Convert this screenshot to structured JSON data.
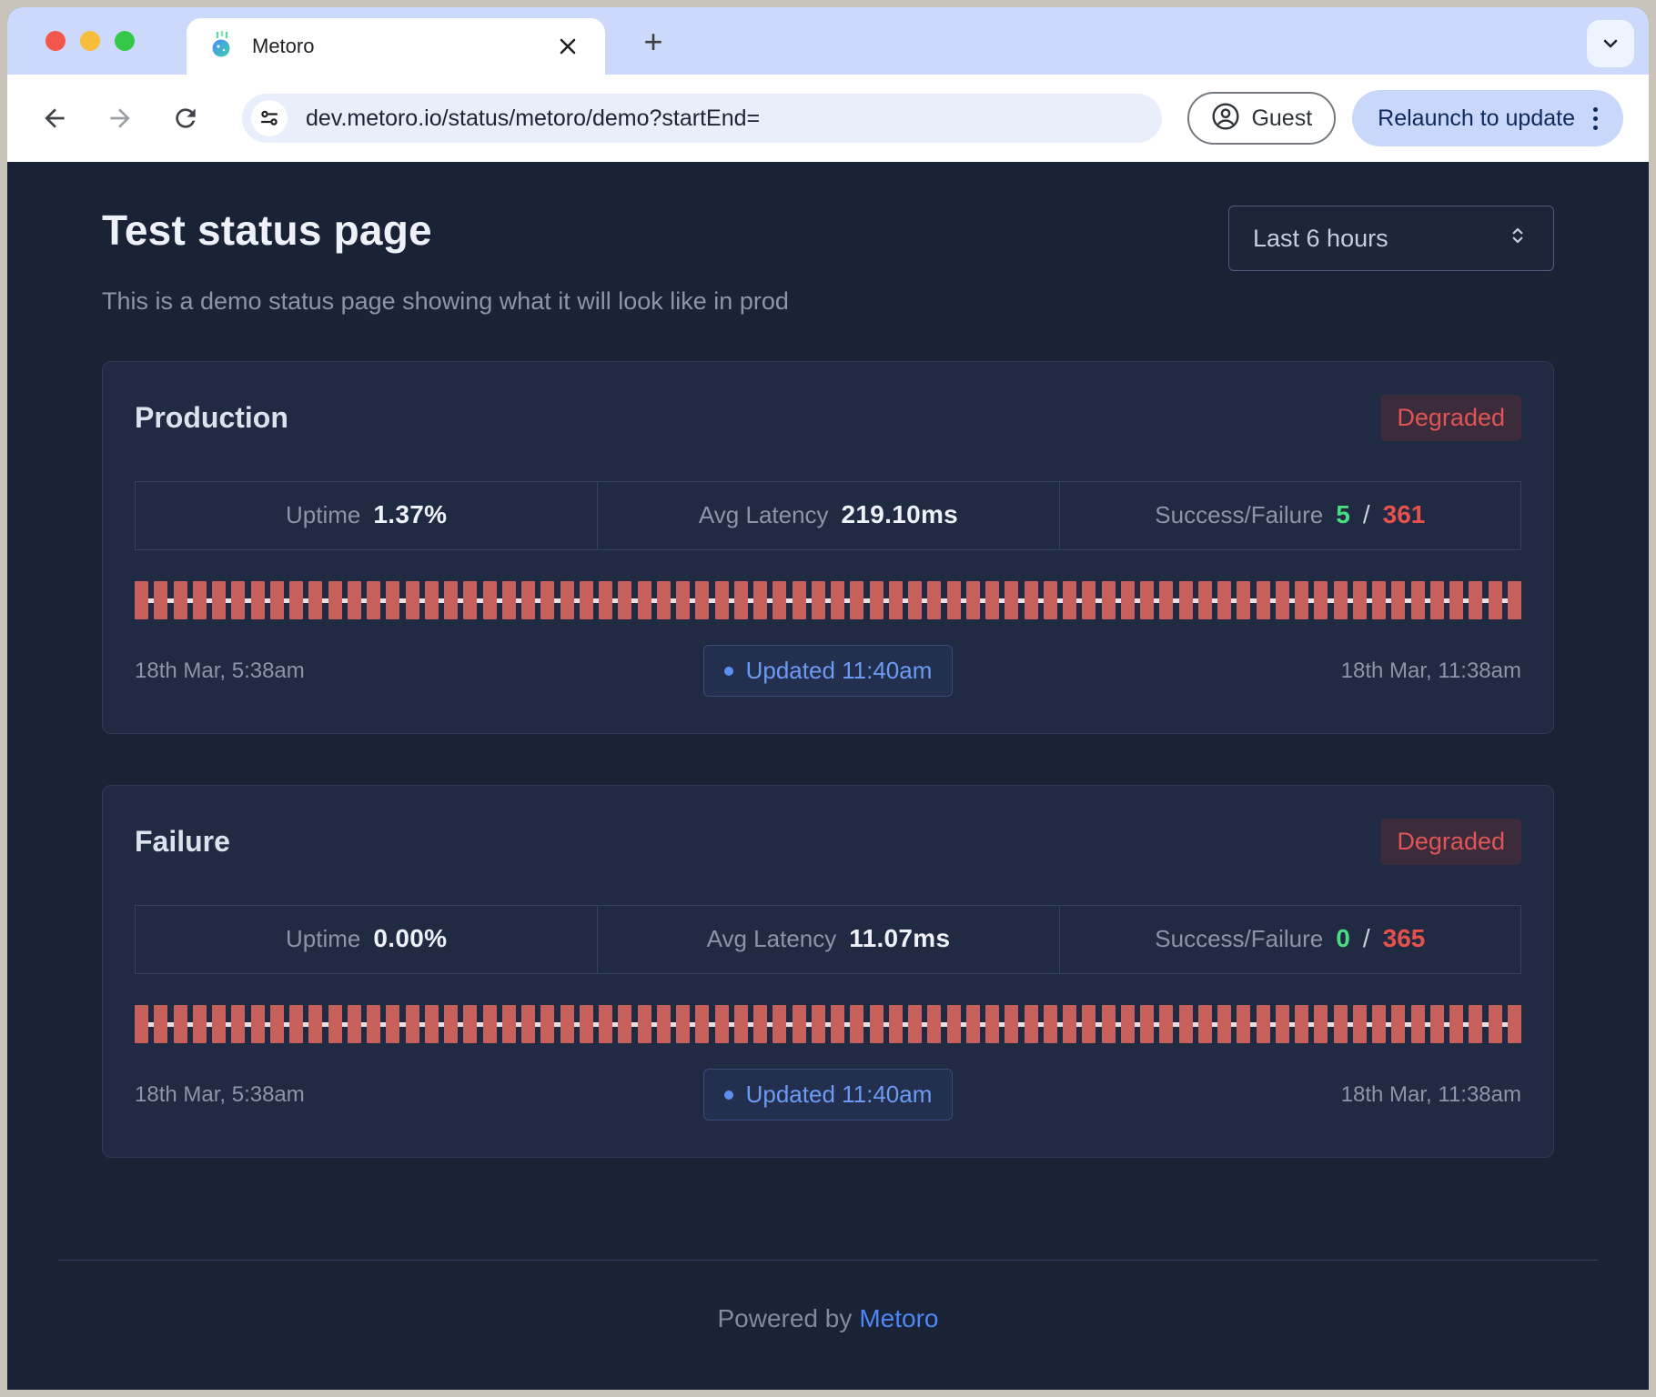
{
  "browser": {
    "tab_title": "Metoro",
    "url": "dev.metoro.io/status/metoro/demo?startEnd=",
    "guest_label": "Guest",
    "relaunch_label": "Relaunch to update"
  },
  "page": {
    "title": "Test status page",
    "subtitle": "This is a demo status page showing what it will look like in prod",
    "time_range": "Last 6 hours",
    "stat_labels": {
      "uptime": "Uptime",
      "latency": "Avg Latency",
      "success_failure": "Success/Failure",
      "sf_separator": "/"
    },
    "footer": {
      "powered_by": "Powered by",
      "brand": "Metoro"
    }
  },
  "services": [
    {
      "name": "Production",
      "status": "Degraded",
      "uptime": "1.37%",
      "latency": "219.10ms",
      "success": "5",
      "failure": "361",
      "start_time": "18th Mar, 5:38am",
      "updated": "Updated 11:40am",
      "end_time": "18th Mar, 11:38am",
      "bars": {
        "count": 72,
        "state": "down",
        "color": "#c7605a"
      }
    },
    {
      "name": "Failure",
      "status": "Degraded",
      "uptime": "0.00%",
      "latency": "11.07ms",
      "success": "0",
      "failure": "365",
      "start_time": "18th Mar, 5:38am",
      "updated": "Updated 11:40am",
      "end_time": "18th Mar, 11:38am",
      "bars": {
        "count": 72,
        "state": "down",
        "color": "#c7605a"
      }
    }
  ],
  "colors": {
    "page_bg": "#1a2236",
    "card_bg": "#202a42",
    "accent_blue": "#4d87f5",
    "success_green": "#4ade80",
    "failure_red": "#e8514b",
    "bar_red": "#c7605a",
    "degraded_text": "#e05555",
    "degraded_bg": "#3c2b3b"
  }
}
